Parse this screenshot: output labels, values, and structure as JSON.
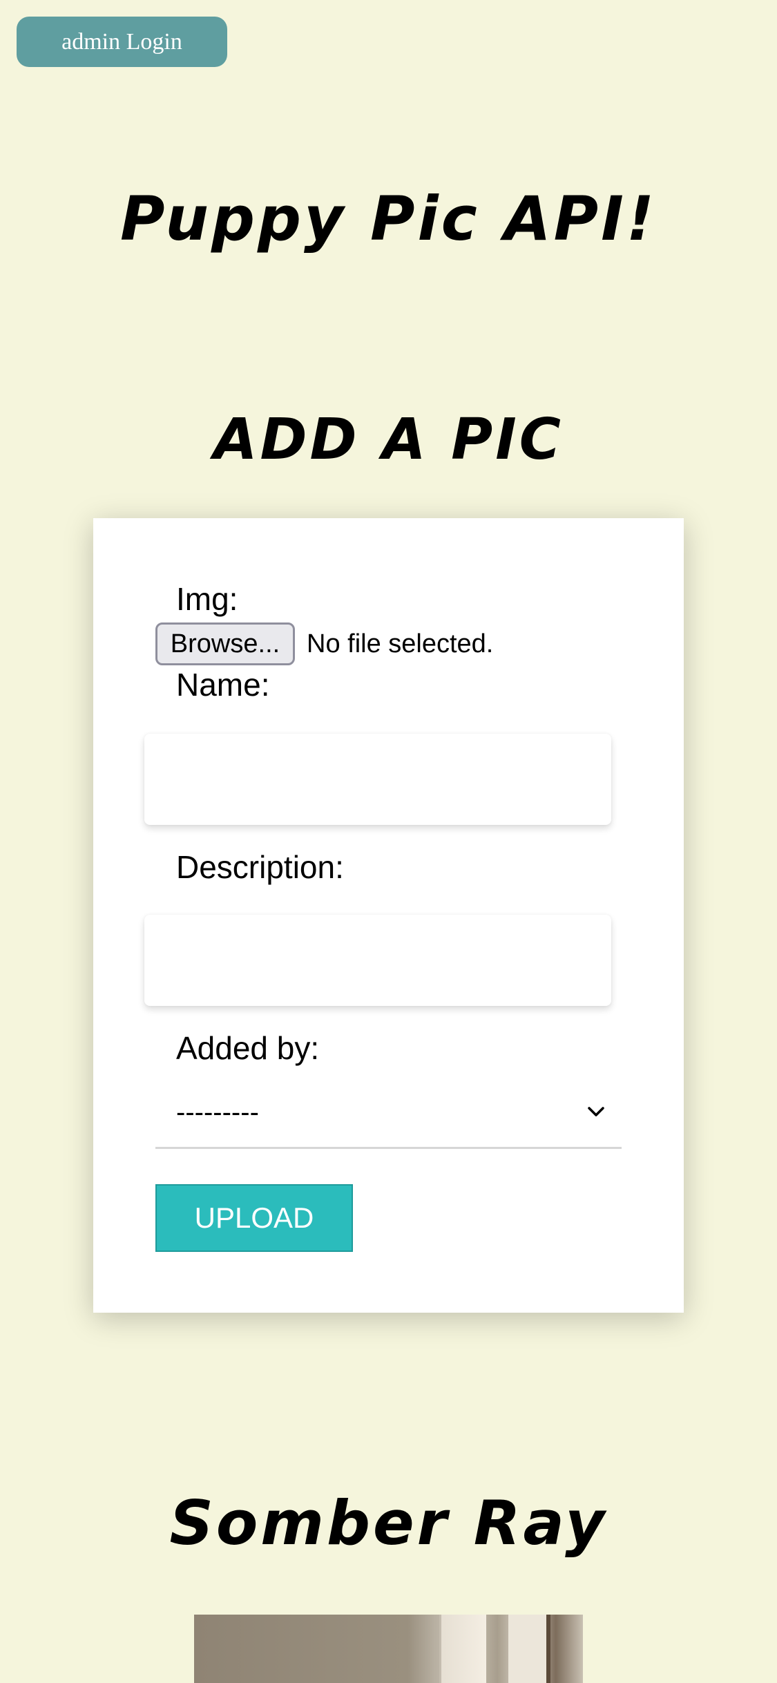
{
  "header": {
    "admin_login_label": "admin Login"
  },
  "site_title": "Puppy Pic API!",
  "add_pic": {
    "title": "ADD A PIC",
    "img_label": "Img:",
    "browse_label": "Browse...",
    "file_status": "No file selected.",
    "name_label": "Name:",
    "name_value": "",
    "description_label": "Description:",
    "description_value": "",
    "added_by_label": "Added by:",
    "added_by_selected": "---------",
    "upload_label": "UPLOAD"
  },
  "pictures": [
    {
      "name": "Somber Ray"
    }
  ],
  "colors": {
    "background": "#f5f5dc",
    "admin_button": "#5f9ea0",
    "upload_button": "#2bbcbc"
  },
  "icons": {
    "select_arrow": "chevron-down-icon"
  }
}
